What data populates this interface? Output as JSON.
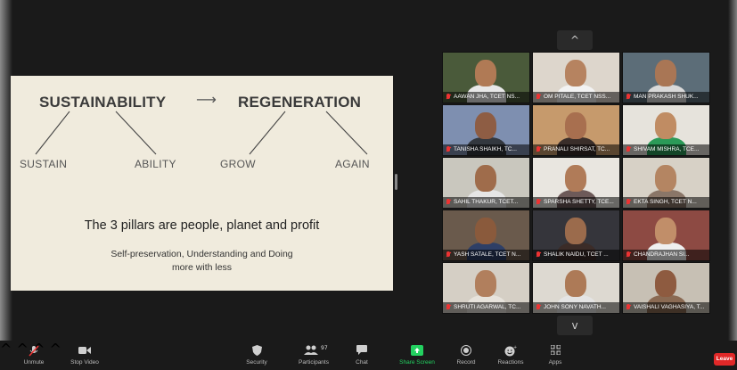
{
  "slide": {
    "left_word": "SUSTAINABILITY",
    "arrow": "⟶",
    "right_word": "REGENERATION",
    "sub1": "SUSTAIN",
    "sub2": "ABILITY",
    "sub3": "GROW",
    "sub4": "AGAIN",
    "pillars": "The 3 pillars are people, planet and profit",
    "desc_line1": "Self-preservation, Understanding and Doing",
    "desc_line2": "more with less"
  },
  "gallery": {
    "nav_up": "^",
    "nav_down": "v",
    "participants": [
      {
        "name": "AAWAN JHA, TCET NS...",
        "bg": "#4a5a3a",
        "skin": "#b07a55",
        "shirt": "#e8e8e8"
      },
      {
        "name": "OM PITALE, TCET NSS...",
        "bg": "#ddd6cc",
        "skin": "#b68360",
        "shirt": "#f2f2f2"
      },
      {
        "name": "MAN PRAKASH SHUK...",
        "bg": "#5c6d78",
        "skin": "#a97655",
        "shirt": "#d9d9d9"
      },
      {
        "name": "TANISHA SHAIKH, TC...",
        "bg": "#7e8fb0",
        "skin": "#8e5d44",
        "shirt": "#33383f"
      },
      {
        "name": "PRANALI SHIRSAT, TC...",
        "bg": "#c69a6c",
        "skin": "#a86f4f",
        "shirt": "#3a2e2a"
      },
      {
        "name": "SHIVAM MISHRA, TCE...",
        "bg": "#e6e3dc",
        "skin": "#c08c63",
        "shirt": "#2b9a58"
      },
      {
        "name": "SAHIL THAKUR, TCET...",
        "bg": "#c9c7be",
        "skin": "#9f6c4b",
        "shirt": "#e6e6e6"
      },
      {
        "name": "SPARSHA SHETTY, TCE...",
        "bg": "#e9e6e0",
        "skin": "#b07b58",
        "shirt": "#6d5a59"
      },
      {
        "name": "EKTA SINGH, TCET N...",
        "bg": "#d7d1c6",
        "skin": "#b48562",
        "shirt": "#8a7668"
      },
      {
        "name": "YASH SATALE, TCET N...",
        "bg": "#6a5a4c",
        "skin": "#8a5a3c",
        "shirt": "#2e3f66"
      },
      {
        "name": "SHALIK NAIDU, TCET ...",
        "bg": "#35353b",
        "skin": "#9b6b4c",
        "shirt": "#3b2c28"
      },
      {
        "name": "CHANDRAJHAN SI...",
        "bg": "#8d4a43",
        "skin": "#c18e69",
        "shirt": "#efefef"
      },
      {
        "name": "SHRUTI AGARWAL, TC...",
        "bg": "#d5cfc5",
        "skin": "#b17f5d",
        "shirt": "#e7e3dc"
      },
      {
        "name": "JOHN SONY NAVATH...",
        "bg": "#ddd9d1",
        "skin": "#ad7a57",
        "shirt": "#e4e4e4"
      },
      {
        "name": "VAISHALI VAGHASIYA, T...",
        "bg": "#c7c0b4",
        "skin": "#8e5b40",
        "shirt": "#8a6a53"
      }
    ]
  },
  "toolbar": {
    "unmute": "Unmute",
    "stop_video": "Stop Video",
    "security": "Security",
    "participants": "Participants",
    "participants_count": "97",
    "chat": "Chat",
    "share_screen": "Share Screen",
    "record": "Record",
    "reactions": "Reactions",
    "apps": "Apps",
    "leave": "Leave",
    "share_color": "#23d160",
    "leave_color": "#e02828"
  }
}
